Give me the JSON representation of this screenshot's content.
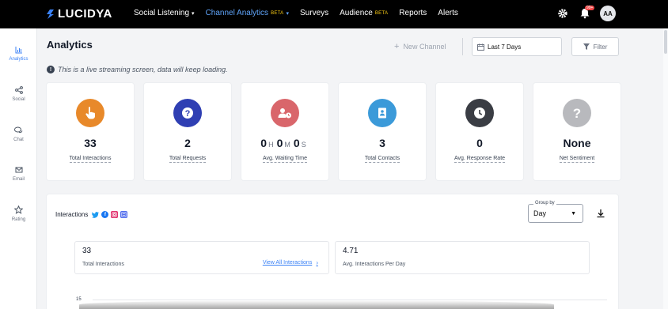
{
  "brand": {
    "name": "LUCIDYA"
  },
  "nav": {
    "items": [
      {
        "label": "Social Listening",
        "dropdown": true,
        "active": false,
        "beta": ""
      },
      {
        "label": "Channel Analytics",
        "dropdown": true,
        "active": true,
        "beta": "BETA"
      },
      {
        "label": "Surveys",
        "dropdown": false,
        "active": false,
        "beta": ""
      },
      {
        "label": "Audience",
        "dropdown": false,
        "active": false,
        "beta": "BETA"
      },
      {
        "label": "Reports",
        "dropdown": false,
        "active": false,
        "beta": ""
      },
      {
        "label": "Alerts",
        "dropdown": false,
        "active": false,
        "beta": ""
      }
    ],
    "notification_badge": "99+",
    "avatar_initials": "AA"
  },
  "sidebar": {
    "items": [
      {
        "label": "Analytics",
        "icon": "bar-chart-icon",
        "active": true
      },
      {
        "label": "Social",
        "icon": "share-icon",
        "active": false
      },
      {
        "label": "Chat",
        "icon": "chat-icon",
        "active": false
      },
      {
        "label": "Email",
        "icon": "mail-icon",
        "active": false
      },
      {
        "label": "Rating",
        "icon": "star-icon",
        "active": false
      }
    ]
  },
  "header": {
    "title": "Analytics",
    "new_channel_label": "New Channel",
    "date_range": "Last 7 Days",
    "filter_label": "Filter"
  },
  "notice": "This is a live streaming screen, data will keep loading.",
  "cards": [
    {
      "value": "33",
      "label": "Total Interactions",
      "icon": "hand-pointer-icon",
      "color": "#e8892a"
    },
    {
      "value": "2",
      "label": "Total Requests",
      "icon": "question-icon",
      "color": "#2f3fb3"
    },
    {
      "value_parts": [
        "0",
        "H",
        "0",
        "M",
        "0",
        "S"
      ],
      "label": "Avg. Waiting Time",
      "icon": "user-clock-icon",
      "color": "#d9666b"
    },
    {
      "value": "3",
      "label": "Total Contacts",
      "icon": "contact-book-icon",
      "color": "#3b9ad9"
    },
    {
      "value": "0",
      "label": "Avg. Response Rate",
      "icon": "clock-icon",
      "color": "#3a3d44"
    },
    {
      "value": "None",
      "label": "Net Sentiment",
      "icon": "question-mark-icon",
      "color": "#b8b9bd"
    }
  ],
  "interactions": {
    "title": "Interactions",
    "group_by_label": "Group by",
    "group_by_value": "Day",
    "stats": [
      {
        "value": "33",
        "label": "Total Interactions",
        "link": "View All Interactions"
      },
      {
        "value": "4.71",
        "label": "Avg. Interactions Per Day"
      }
    ],
    "axis_tick": "15"
  },
  "colors": {
    "accent": "#3b82f6",
    "nav_bg": "#000000",
    "beta": "#facc15"
  }
}
